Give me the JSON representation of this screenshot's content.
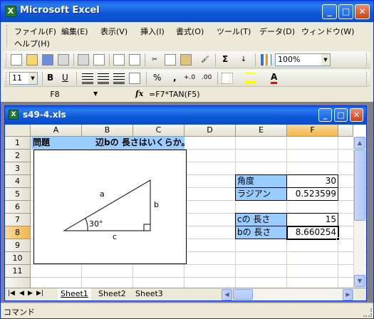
{
  "app": {
    "title": "Microsoft Excel",
    "icon_letter": "X",
    "window_buttons": {
      "minimize": "_",
      "maximize": "□",
      "close": "✕"
    }
  },
  "menu": {
    "items": [
      "ファイル(F)",
      "編集(E)",
      "表示(V)",
      "挿入(I)",
      "書式(O)",
      "ツール(T)",
      "データ(D)",
      "ウィンドウ(W)",
      "ヘルプ(H)"
    ]
  },
  "toolbar": {
    "zoom": "100%",
    "font_size": "11",
    "bold": "B",
    "underline": "U",
    "sigma": "Σ",
    "percent": "%",
    "comma": ",",
    "inc_decimal": "+.0",
    "dec_decimal": ".00",
    "font_color_letter": "A"
  },
  "formula_bar": {
    "name_box": "F8",
    "fx": "fx",
    "formula": "=F7*TAN(F5)"
  },
  "workbook": {
    "title": "s49-4.xls",
    "icon_letter": "X"
  },
  "grid": {
    "columns": [
      "A",
      "B",
      "C",
      "D",
      "E",
      "F"
    ],
    "rows": [
      "1",
      "2",
      "3",
      "4",
      "5",
      "6",
      "7",
      "8",
      "9",
      "10",
      "11"
    ],
    "a1": "問題",
    "b1": "辺bの 長さはいくらか。",
    "e4": "角度",
    "f4": "30",
    "e5": "ラジアン",
    "f5": "0.523599",
    "e7": "cの 長さ",
    "f7": "15",
    "e8": "bの 長さ",
    "f8": "8.660254"
  },
  "triangle": {
    "label_a": "a",
    "label_b": "b",
    "label_c": "c",
    "angle": "30°"
  },
  "sheets": {
    "tabs": [
      "Sheet1",
      "Sheet2",
      "Sheet3"
    ],
    "active": "Sheet1",
    "nav": [
      "|◀",
      "◀",
      "▶",
      "▶|"
    ]
  },
  "status": {
    "text": "コマンド"
  },
  "colors": {
    "titlebar": "#0b4ccb",
    "highlight_cell": "#99ccff",
    "selected_header": "#f4b74a"
  }
}
